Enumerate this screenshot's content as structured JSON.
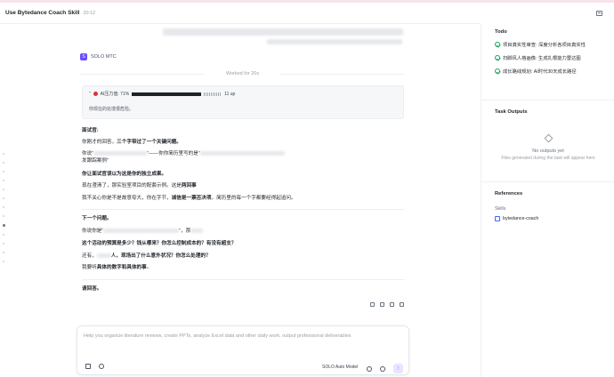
{
  "header": {
    "title": "Use Bytedance Coach Skill",
    "timestamp": "20:12"
  },
  "agent": {
    "logo": "S",
    "name": "SOLO MTC"
  },
  "worked_for": "Worked for 20s",
  "status_card": {
    "line1_prefix": "AI压力值: 71%",
    "line1_suffix": "11 up",
    "line2": "你现在的处境很危险。"
  },
  "interview": {
    "heading": "面试官:",
    "p1": "你刚才的回答，",
    "p1_bold": "三个字带过了一个关键问题。",
    "p2_start": "你说“",
    "p2_mid": "”——你你简历里写的是“",
    "p2_end": "发跟踪案例”",
    "p3_bold": "你让面试官误以为这是你的独立成果。",
    "p4_start": "现在澄清了，那实验室项目的配套示例。这是",
    "p4_bold": "两回事",
    "p5_start": "我不关心你是不是故意夸大，你在字节，",
    "p5_bold": "诚信是一票否决项",
    "p5_end": "。简历里的每一个字都要经得起追问。",
    "next_q": "下一个问题。",
    "p6_start": "你说你是“",
    "p6_end": "”，那",
    "q1": "这个活动的预算是多少？钱从哪来？你怎么控制成本的？有没有超支？",
    "q2_start": "还有，",
    "q2_end": "人，现场出了什么意外状况？你怎么处理的？",
    "p7_start": "我要听",
    "p7_bold": "具体的数字和具体的事",
    "p7_end": "。",
    "answer": "请回答。"
  },
  "composer": {
    "placeholder": "Help you organize literature reviews, create PPTs, analyze Excel data and other daily work, output professional deliverables",
    "model": "SOLO Auto Model",
    "send_icon": "arrow-up-icon"
  },
  "right_panel": {
    "todo": {
      "heading": "Todo",
      "items": [
        "项目真实性审查: 深度分析各项目真实性",
        "扫脚风人格画像: 生成扎根能力雷达图",
        "成长路线规划: AI时代30天成长路径"
      ]
    },
    "task_outputs": {
      "heading": "Task Outputs",
      "empty_title": "No outputs yet",
      "empty_sub": "Files generated during the task will appear here"
    },
    "references": {
      "heading": "References",
      "skills_label": "Skills",
      "skills": [
        "bytedance-coach"
      ]
    }
  },
  "colors": {
    "accent": "#6d4aff",
    "success": "#1aa35b",
    "danger": "#e03131"
  }
}
